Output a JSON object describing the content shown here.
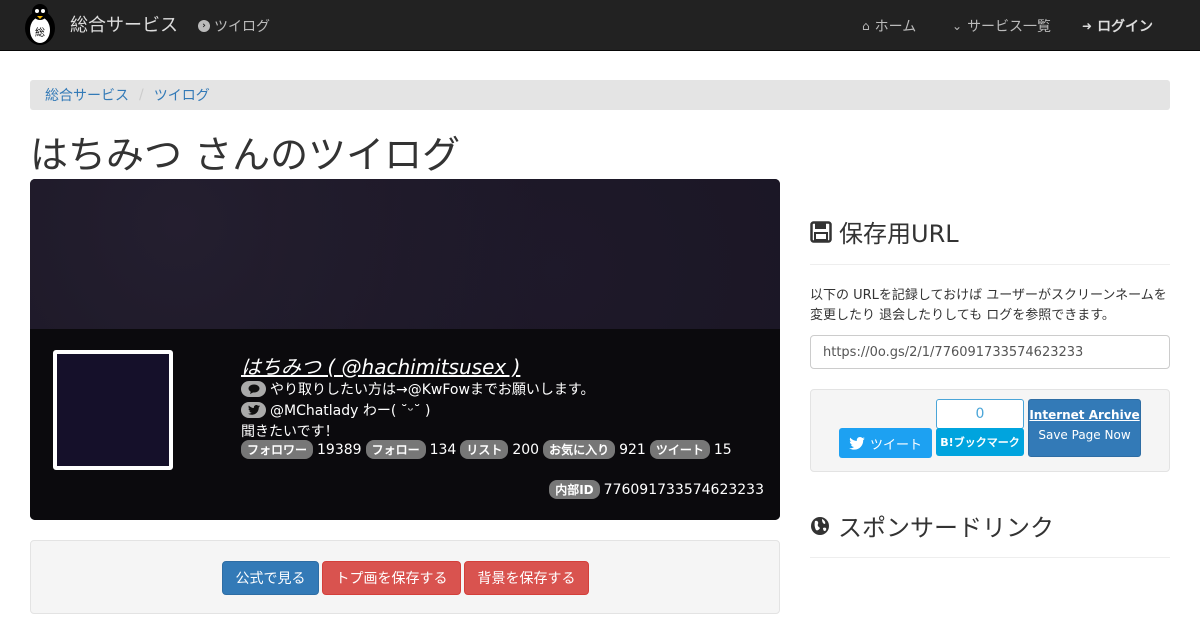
{
  "navbar": {
    "brand": "総合サービス",
    "twilog": "ツイログ",
    "home": "ホーム",
    "services": "サービス一覧",
    "login": "ログイン"
  },
  "breadcrumb": [
    "総合サービス",
    "ツイログ"
  ],
  "page_title": "はちみつ さんのツイログ",
  "profile": {
    "name": "はちみつ ( @hachimitsusex )",
    "bio_line1": "やり取りしたい方は→@KwFowまでお願いします。",
    "bio_line2": "@MChatlady わー( ˘ᵕ˘ )",
    "bio_line3": "聞きたいです！",
    "stats": [
      {
        "label": "フォロワー",
        "value": "19389"
      },
      {
        "label": "フォロー",
        "value": "134"
      },
      {
        "label": "リスト",
        "value": "200"
      },
      {
        "label": "お気に入り",
        "value": "921"
      },
      {
        "label": "ツイート",
        "value": "15"
      }
    ],
    "internal_id_label": "内部ID",
    "internal_id": "776091733574623233"
  },
  "actions": {
    "official": "公式で見る",
    "save_header": "トプ画を保存する",
    "save_background": "背景を保存する"
  },
  "sidebar": {
    "save_url_title": "保存用URL",
    "description": "以下の URLを記録しておけば ユーザーがスクリーンネームを変更したり 退会したりしても ログを参照できます。",
    "url": "https://0o.gs/2/1/776091733574623233",
    "tweet_label": "ツイート",
    "hatena_count": "0",
    "hatena_label": "B!ブックマーク",
    "ia_title": "Internet Archive",
    "ia_sub": "Save Page Now",
    "sponsored_title": "スポンサードリンク"
  },
  "colors": {
    "navbar": "#222222",
    "link": "#337ab7",
    "btn_blue": "#337ab7",
    "btn_red": "#d9534f",
    "twitter": "#1da1f2",
    "hatena": "#00a4de"
  }
}
